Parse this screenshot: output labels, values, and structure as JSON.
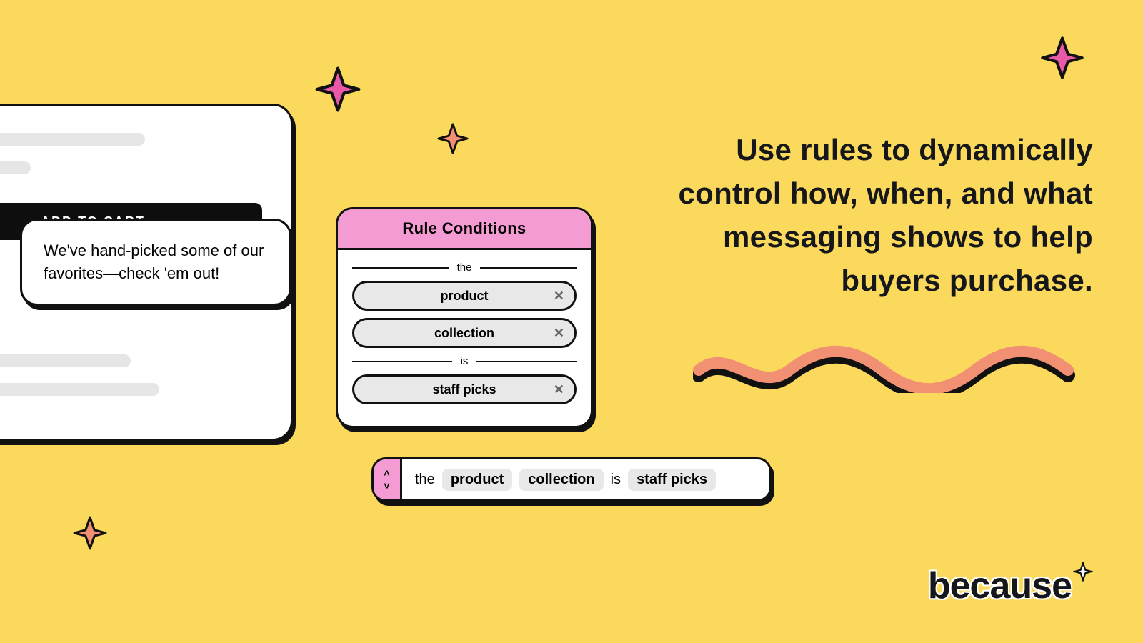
{
  "headline": "Use rules to dynamically control how, when, and what messaging shows to help buyers purchase.",
  "productCard": {
    "addToCart": "ADD TO CART",
    "favoritesText": "We've hand-picked some of our favorites—check 'em out!"
  },
  "rulePanel": {
    "title": "Rule Conditions",
    "sep1": "the",
    "sep2": "is",
    "options": [
      "product",
      "collection",
      "staff picks"
    ]
  },
  "summary": {
    "word1": "the",
    "tag1": "product",
    "tag2": "collection",
    "word2": "is",
    "tag3": "staff picks"
  },
  "logo": "because",
  "colors": {
    "pink": "#e85aa7",
    "orange": "#f19073"
  }
}
